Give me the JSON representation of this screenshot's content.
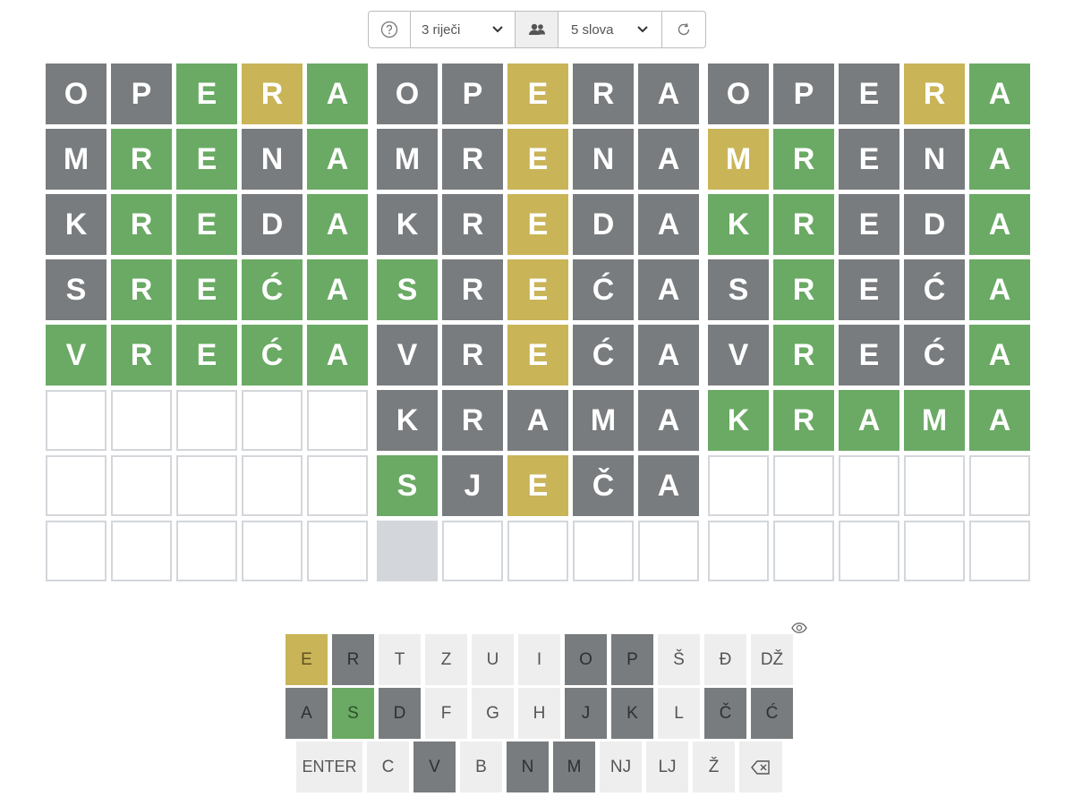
{
  "toolbar": {
    "help_icon": "help-circle-icon",
    "words_label": "3 riječi",
    "players_icon": "users-icon",
    "length_label": "5 slova",
    "refresh_icon": "refresh-icon"
  },
  "colors": {
    "green": "#6aaa64",
    "yellow": "#c9b458",
    "gray": "#787c7e",
    "empty_border": "#d3d6da",
    "key_bg": "#eeeeee"
  },
  "boards": [
    {
      "rows": [
        [
          "O",
          "P",
          "E",
          "R",
          "A"
        ],
        [
          "M",
          "R",
          "E",
          "N",
          "A"
        ],
        [
          "K",
          "R",
          "E",
          "D",
          "A"
        ],
        [
          "S",
          "R",
          "E",
          "Ć",
          "A"
        ],
        [
          "V",
          "R",
          "E",
          "Ć",
          "A"
        ],
        [
          "",
          "",
          "",
          "",
          ""
        ],
        [
          "",
          "",
          "",
          "",
          ""
        ],
        [
          "",
          "",
          "",
          "",
          ""
        ]
      ],
      "states": [
        [
          "x",
          "x",
          "g",
          "y",
          "g"
        ],
        [
          "x",
          "g",
          "g",
          "x",
          "g"
        ],
        [
          "x",
          "g",
          "g",
          "x",
          "g"
        ],
        [
          "x",
          "g",
          "g",
          "g",
          "g"
        ],
        [
          "g",
          "g",
          "g",
          "g",
          "g"
        ],
        [
          "e",
          "e",
          "e",
          "e",
          "e"
        ],
        [
          "e",
          "e",
          "e",
          "e",
          "e"
        ],
        [
          "e",
          "e",
          "e",
          "e",
          "e"
        ]
      ]
    },
    {
      "rows": [
        [
          "O",
          "P",
          "E",
          "R",
          "A"
        ],
        [
          "M",
          "R",
          "E",
          "N",
          "A"
        ],
        [
          "K",
          "R",
          "E",
          "D",
          "A"
        ],
        [
          "S",
          "R",
          "E",
          "Ć",
          "A"
        ],
        [
          "V",
          "R",
          "E",
          "Ć",
          "A"
        ],
        [
          "K",
          "R",
          "A",
          "M",
          "A"
        ],
        [
          "S",
          "J",
          "E",
          "Č",
          "A"
        ],
        [
          "",
          "",
          "",
          "",
          ""
        ]
      ],
      "states": [
        [
          "x",
          "x",
          "y",
          "x",
          "x"
        ],
        [
          "x",
          "x",
          "y",
          "x",
          "x"
        ],
        [
          "x",
          "x",
          "y",
          "x",
          "x"
        ],
        [
          "g",
          "x",
          "y",
          "x",
          "x"
        ],
        [
          "x",
          "x",
          "y",
          "x",
          "x"
        ],
        [
          "x",
          "x",
          "x",
          "x",
          "x"
        ],
        [
          "g",
          "x",
          "y",
          "x",
          "x"
        ],
        [
          "c",
          "e",
          "e",
          "e",
          "e"
        ]
      ]
    },
    {
      "rows": [
        [
          "O",
          "P",
          "E",
          "R",
          "A"
        ],
        [
          "M",
          "R",
          "E",
          "N",
          "A"
        ],
        [
          "K",
          "R",
          "E",
          "D",
          "A"
        ],
        [
          "S",
          "R",
          "E",
          "Ć",
          "A"
        ],
        [
          "V",
          "R",
          "E",
          "Ć",
          "A"
        ],
        [
          "K",
          "R",
          "A",
          "M",
          "A"
        ],
        [
          "",
          "",
          "",
          "",
          ""
        ],
        [
          "",
          "",
          "",
          "",
          ""
        ]
      ],
      "states": [
        [
          "x",
          "x",
          "x",
          "y",
          "g"
        ],
        [
          "y",
          "g",
          "x",
          "x",
          "g"
        ],
        [
          "g",
          "g",
          "x",
          "x",
          "g"
        ],
        [
          "x",
          "g",
          "x",
          "x",
          "g"
        ],
        [
          "x",
          "g",
          "x",
          "x",
          "g"
        ],
        [
          "g",
          "g",
          "g",
          "g",
          "g"
        ],
        [
          "e",
          "e",
          "e",
          "e",
          "e"
        ],
        [
          "e",
          "e",
          "e",
          "e",
          "e"
        ]
      ]
    }
  ],
  "keyboard": {
    "visibility_icon": "eye-icon",
    "rows": [
      [
        {
          "k": "E",
          "s": "y"
        },
        {
          "k": "R",
          "s": "x"
        },
        {
          "k": "T",
          "s": ""
        },
        {
          "k": "Z",
          "s": ""
        },
        {
          "k": "U",
          "s": ""
        },
        {
          "k": "I",
          "s": ""
        },
        {
          "k": "O",
          "s": "x"
        },
        {
          "k": "P",
          "s": "x"
        },
        {
          "k": "Š",
          "s": ""
        },
        {
          "k": "Đ",
          "s": ""
        },
        {
          "k": "DŽ",
          "s": ""
        }
      ],
      [
        {
          "k": "A",
          "s": "x"
        },
        {
          "k": "S",
          "s": "g"
        },
        {
          "k": "D",
          "s": "x"
        },
        {
          "k": "F",
          "s": ""
        },
        {
          "k": "G",
          "s": ""
        },
        {
          "k": "H",
          "s": ""
        },
        {
          "k": "J",
          "s": "x"
        },
        {
          "k": "K",
          "s": "x"
        },
        {
          "k": "L",
          "s": ""
        },
        {
          "k": "Č",
          "s": "x"
        },
        {
          "k": "Ć",
          "s": "x"
        }
      ],
      [
        {
          "k": "ENTER",
          "s": "",
          "w": "wide"
        },
        {
          "k": "C",
          "s": ""
        },
        {
          "k": "V",
          "s": "x"
        },
        {
          "k": "B",
          "s": ""
        },
        {
          "k": "N",
          "s": "x"
        },
        {
          "k": "M",
          "s": "x"
        },
        {
          "k": "NJ",
          "s": ""
        },
        {
          "k": "LJ",
          "s": ""
        },
        {
          "k": "Ž",
          "s": ""
        },
        {
          "k": "",
          "s": "",
          "w": "back",
          "icon": "backspace-icon"
        }
      ]
    ]
  }
}
